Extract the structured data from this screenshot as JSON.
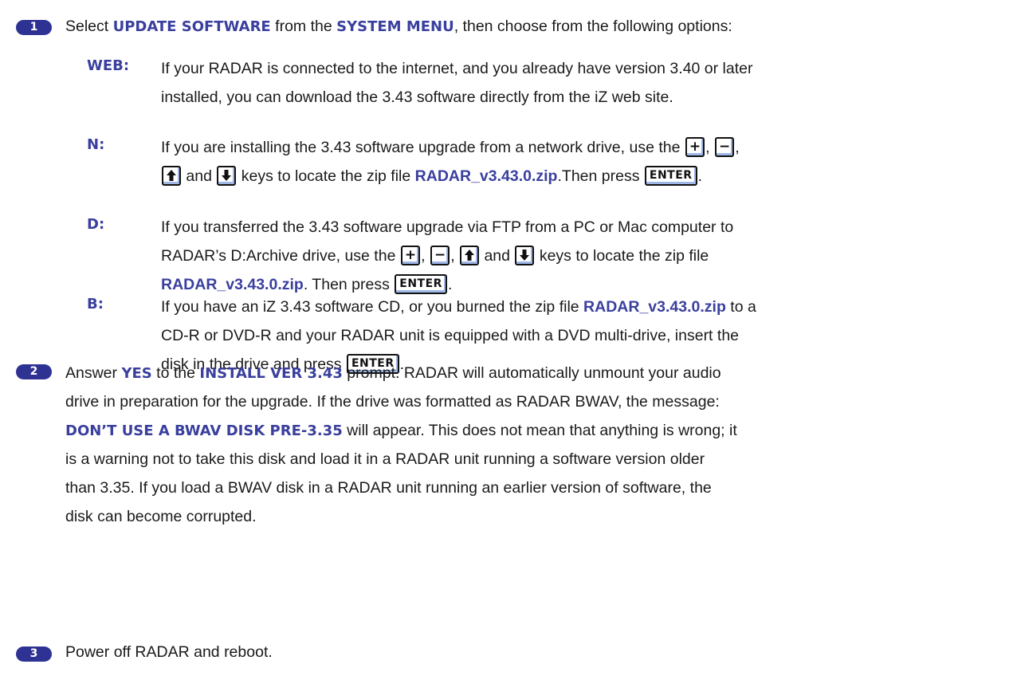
{
  "steps": [
    {
      "number": "1",
      "t1": "Select ",
      "h1": "UPDATE SOFTWARE",
      "t2": " from the ",
      "h2": "SYSTEM MENU",
      "t3": ", then choose from the following options:"
    },
    {
      "number": "2",
      "t1": "Answer ",
      "h1": "YES",
      "t2": " to the ",
      "h2": "INSTALL VER 3.43",
      "t3": " prompt. RADAR will automatically unmount your audio",
      "l2": "drive in preparation for the upgrade. If the drive was formatted as RADAR BWAV, the message:",
      "h3": "DON’T USE A BWAV DISK PRE-3.35",
      "t4": " will appear. This does not mean that anything is wrong; it",
      "l4": "is a warning not to take this disk and load it in a RADAR unit running a software version older",
      "l5": "than 3.35. If you load a BWAV disk in a RADAR unit running an earlier version of software, the",
      "l6": "disk can become corrupted."
    },
    {
      "number": "3",
      "text": "Power off RADAR and reboot."
    }
  ],
  "options": [
    {
      "label": "WEB:",
      "l1": "If your RADAR is connected to the internet, and you already have version 3.40 or later",
      "l2": "installed, you can download the 3.43 software directly from the iZ web site."
    },
    {
      "label": "N:",
      "a": "If you are installing the 3.43 software upgrade from a network drive, use the ",
      "b": " and ",
      "c": " keys to locate the zip file ",
      "file": "RADAR_v3.43.0.zip",
      "d": ".Then press "
    },
    {
      "label": "D:",
      "l1": "If you transferred the 3.43 software upgrade via FTP from a PC or Mac computer to",
      "a": "RADAR’s D:Archive drive, use the ",
      "b": " and ",
      "c": " keys to locate the zip file",
      "file": "RADAR_v3.43.0.zip",
      "d": ". Then press "
    },
    {
      "label": "B:",
      "a": "If you have an iZ 3.43 software CD, or you burned the zip file ",
      "file": "RADAR_v3.43.0.zip",
      "b": " to a",
      "l2": "CD-R or DVD-R and your RADAR unit is equipped with a DVD multi-drive, insert the",
      "c": "disk in the drive and press "
    }
  ],
  "keys": {
    "plus": "+",
    "minus": "−",
    "enter": "ENTER",
    "comma": ",",
    "period": ".",
    "up_icon": "arrow-up-icon",
    "down_icon": "arrow-down-icon"
  },
  "colors": {
    "badge": "#2e3292",
    "highlight": "#3a3f9e",
    "key_shadow": "#9fb7e6"
  }
}
